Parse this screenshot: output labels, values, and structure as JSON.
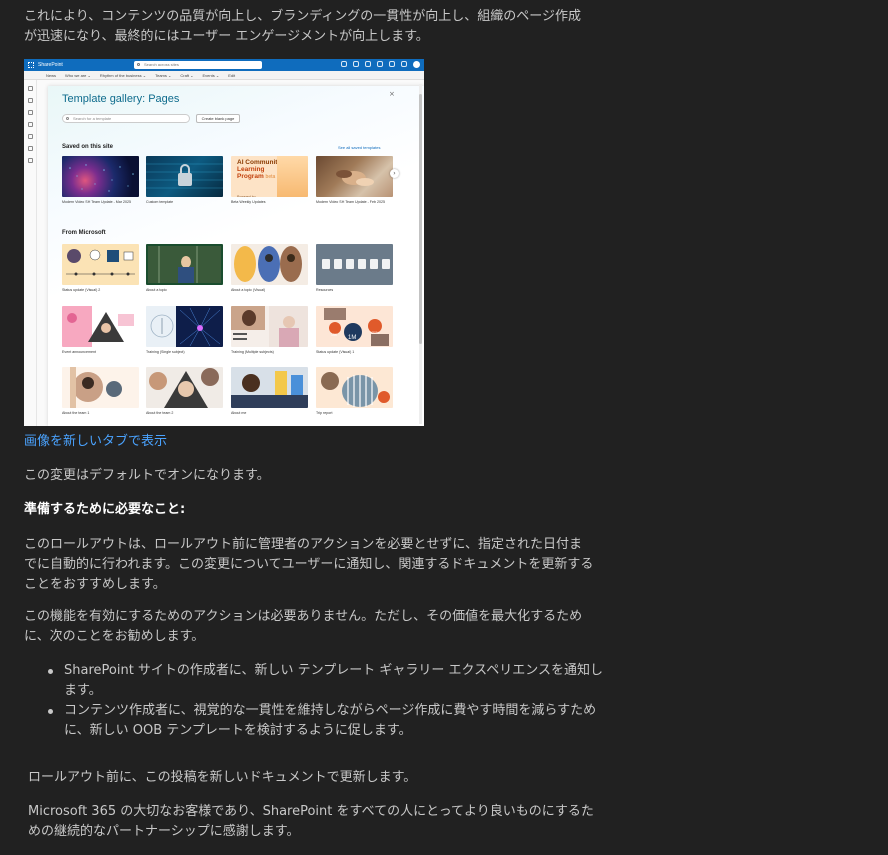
{
  "article": {
    "intro": "これにより、コンテンツの品質が向上し、ブランディングの一貫性が向上し、組織のページ作成が迅速になり、最終的にはユーザー エンゲージメントが向上します。",
    "open_image_link": "画像を新しいタブで表示",
    "default_on": "この変更はデフォルトでオンになります。",
    "prepare_heading": "準備するために必要なこと:",
    "rollout_note": "このロールアウトは、ロールアウト前に管理者のアクションを必要とせずに、指定された日付までに自動的に行われます。この変更についてユーザーに通知し、関連するドキュメントを更新することをおすすめします。",
    "enable_note": "この機能を有効にするためのアクションは必要ありません。ただし、その価値を最大化するために、次のことをお勧めします。",
    "bullets": [
      "SharePoint サイトの作成者に、新しい テンプレート ギャラリー エクスペリエンスを通知します。",
      "コンテンツ作成者に、視覚的な一貫性を維持しながらページ作成に費やす時間を減らすために、新しい OOB テンプレートを検討するように促します。"
    ],
    "update_docs": "ロールアウト前に、この投稿を新しいドキュメントで更新します。",
    "thanks": "Microsoft 365 の大切なお客様であり、SharePoint をすべての人にとってより良いものにするための継続的なパートナーシップに感謝します。"
  },
  "screenshot": {
    "app_name": "SharePoint",
    "search_placeholder": "Search across sites",
    "nav_items": [
      "News",
      "Who we are ⌄",
      "Rhythm of the business ⌄",
      "Teams ⌄",
      "Craft ⌄",
      "Events ⌄",
      "Edit"
    ],
    "dialog_title": "Template gallery: Pages",
    "close_glyph": "×",
    "template_search_placeholder": "Search for a template",
    "create_blank": "Create blank page",
    "saved_heading": "Saved on this site",
    "see_all": "See all saved templates",
    "from_ms_heading": "From Microsoft",
    "next_glyph": "›",
    "saved_templates": [
      "Modern Video SH Team Update - Mar 2025",
      "Custom template",
      "Beta Weekly Updates",
      "Modern Video SH Team Update - Feb 2025"
    ],
    "beta_card": {
      "line1": "AI Community",
      "line2": "Learning",
      "line3": "Program",
      "tag": "beta",
      "powered": "Powered by"
    },
    "status_badges": [
      "15K",
      "1M",
      "+20%"
    ],
    "microsoft_templates": [
      "Status update (Visual) 2",
      "About a topic",
      "About a topic (Visual)",
      "Resources",
      "Event announcement",
      "Training (Single subject)",
      "Training (Multiple subjects)",
      "Status update (Visual) 1",
      "About the team 1",
      "About the team 2",
      "About me",
      "Trip report"
    ]
  }
}
